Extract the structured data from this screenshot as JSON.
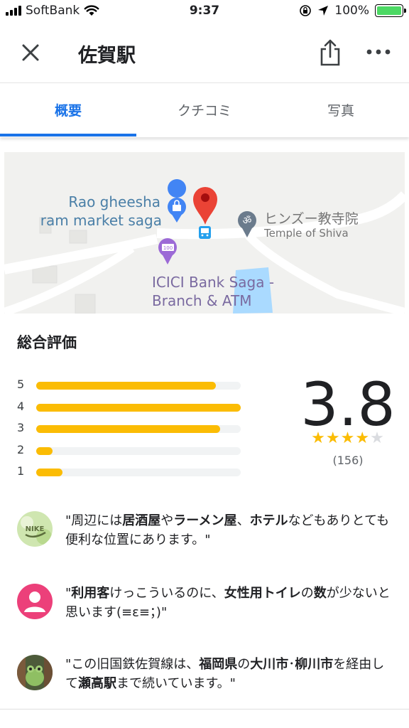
{
  "status_bar": {
    "carrier": "SoftBank",
    "time": "9:37",
    "battery": "100%",
    "icons": [
      "signal-icon",
      "wifi-icon",
      "rotation-lock-icon",
      "location-arrow-icon",
      "battery-icon"
    ]
  },
  "header": {
    "title": "佐賀駅",
    "icons": [
      "close-icon",
      "share-icon",
      "more-icon"
    ]
  },
  "tabs": [
    {
      "label": "概要",
      "active": true
    },
    {
      "label": "クチコミ",
      "active": false
    },
    {
      "label": "写真",
      "active": false
    }
  ],
  "map": {
    "labels": {
      "place1_line1": "Rao gheesha",
      "place1_line2": "ram market saga",
      "place2_line1": "ヒンズー教寺院",
      "place2_line2": "Temple of Shiva",
      "place3_line1": "ICICI Bank Saga -",
      "place3_line2": "Branch & ATM",
      "atm_badge": "100"
    },
    "colors": {
      "pin": "#ea4335",
      "poi_blue": "#4285f4",
      "road": "#ffffff",
      "water": "#aadaff",
      "land": "#f1f1ef"
    }
  },
  "rating": {
    "title": "総合評価",
    "score": "3.8",
    "review_count": "(156)",
    "stars_filled": 4,
    "stars_total": 5,
    "distribution": [
      {
        "label": "5",
        "fraction": 0.88
      },
      {
        "label": "4",
        "fraction": 1.0
      },
      {
        "label": "3",
        "fraction": 0.9
      },
      {
        "label": "2",
        "fraction": 0.08
      },
      {
        "label": "1",
        "fraction": 0.13
      }
    ],
    "bar_color": "#fbbc04"
  },
  "reviews": [
    {
      "avatar": "nike-avatar",
      "parts": [
        {
          "t": "\"周辺には",
          "b": false
        },
        {
          "t": "居酒屋",
          "b": true
        },
        {
          "t": "や",
          "b": false
        },
        {
          "t": "ラーメン屋",
          "b": true
        },
        {
          "t": "、",
          "b": false
        },
        {
          "t": "ホテル",
          "b": true
        },
        {
          "t": "などもありとても便利な位置にあります。\"",
          "b": false
        }
      ]
    },
    {
      "avatar": "default-user-avatar",
      "parts": [
        {
          "t": "\"",
          "b": false
        },
        {
          "t": "利用客",
          "b": true
        },
        {
          "t": "けっこういるのに、",
          "b": false
        },
        {
          "t": "女性用トイレ",
          "b": true
        },
        {
          "t": "の",
          "b": false
        },
        {
          "t": "数",
          "b": true
        },
        {
          "t": "が少ないと思います(≡ε≡；)\"",
          "b": false
        }
      ]
    },
    {
      "avatar": "frog-avatar",
      "parts": [
        {
          "t": "\"この旧国鉄佐賀線は、",
          "b": false
        },
        {
          "t": "福岡県",
          "b": true
        },
        {
          "t": "の",
          "b": false
        },
        {
          "t": "大川市",
          "b": true
        },
        {
          "t": "･",
          "b": false
        },
        {
          "t": "柳川市",
          "b": true
        },
        {
          "t": "を経由して",
          "b": false
        },
        {
          "t": "瀬高駅",
          "b": true
        },
        {
          "t": "まで続いています。\"",
          "b": false
        }
      ]
    }
  ]
}
